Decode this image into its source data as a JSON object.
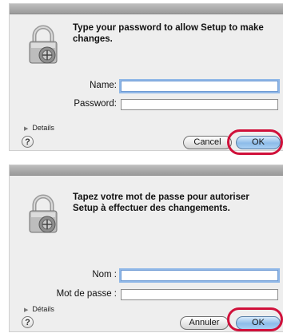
{
  "dialogs": [
    {
      "message": "Type your password to allow Setup to make changes.",
      "name_label": "Name:",
      "password_label": "Password:",
      "details_label": "Details",
      "help_symbol": "?",
      "cancel_label": "Cancel",
      "ok_label": "OK"
    },
    {
      "message": "Tapez votre mot de passe pour autoriser Setup à effectuer des changements.",
      "name_label": "Nom :",
      "password_label": "Mot de passe :",
      "details_label": "Détails",
      "help_symbol": "?",
      "cancel_label": "Annuler",
      "ok_label": "OK"
    }
  ],
  "icons": [
    "lock-icon",
    "disclosure-triangle-icon",
    "help-icon"
  ],
  "colors": {
    "callout": "#d0103a",
    "default_button": "#8dbce9",
    "dialog_bg": "#eeeeee"
  }
}
